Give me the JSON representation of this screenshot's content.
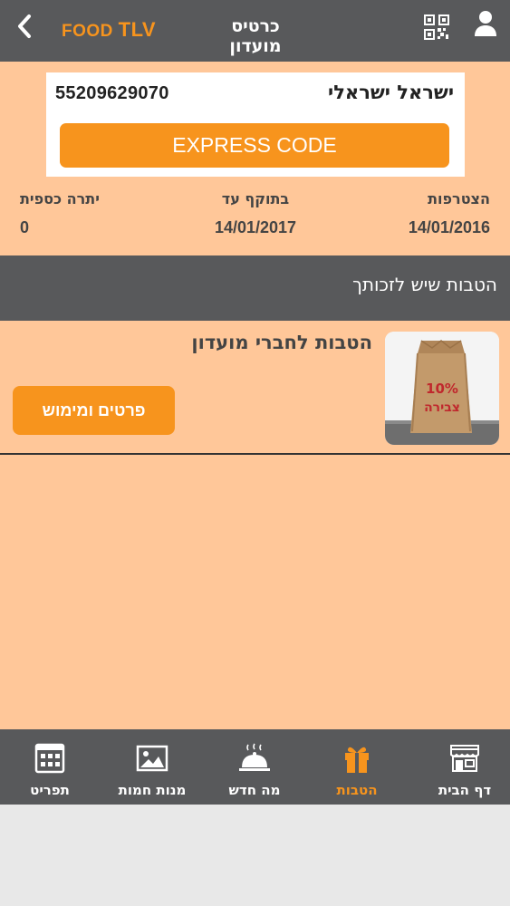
{
  "header": {
    "brand_part1": "FOOD",
    "brand_part2": "TLV",
    "title": "כרטיס מועדון",
    "back_icon": "chevron-left-icon",
    "qr_icon": "qr-code-icon",
    "user_icon": "user-icon"
  },
  "card": {
    "member_name": "ישראל ישראלי",
    "member_number": "55209629070",
    "express_label": "EXPRESS CODE"
  },
  "info": {
    "join_label": "הצטרפות",
    "join_value": "14/01/2016",
    "valid_label": "בתוקף עד",
    "valid_value": "14/01/2017",
    "balance_label": "יתרה כספית",
    "balance_value": "0"
  },
  "section": {
    "title": "הטבות שיש לזכותך"
  },
  "benefits": [
    {
      "title": "הטבות לחברי מועדון",
      "image_text_1": "10%",
      "image_text_2": "צבירה",
      "button_label": "פרטים ומימוש"
    }
  ],
  "nav": {
    "items": [
      {
        "label": "דף הבית",
        "icon": "storefront-icon"
      },
      {
        "label": "הטבות",
        "icon": "gift-icon"
      },
      {
        "label": "מה חדש",
        "icon": "cloche-icon"
      },
      {
        "label": "מנות חמות",
        "icon": "image-icon"
      },
      {
        "label": "תפריט",
        "icon": "calendar-icon"
      }
    ],
    "active_index": 1
  },
  "colors": {
    "accent": "#f7941d",
    "background": "#ffc799",
    "bar": "#58595b"
  }
}
